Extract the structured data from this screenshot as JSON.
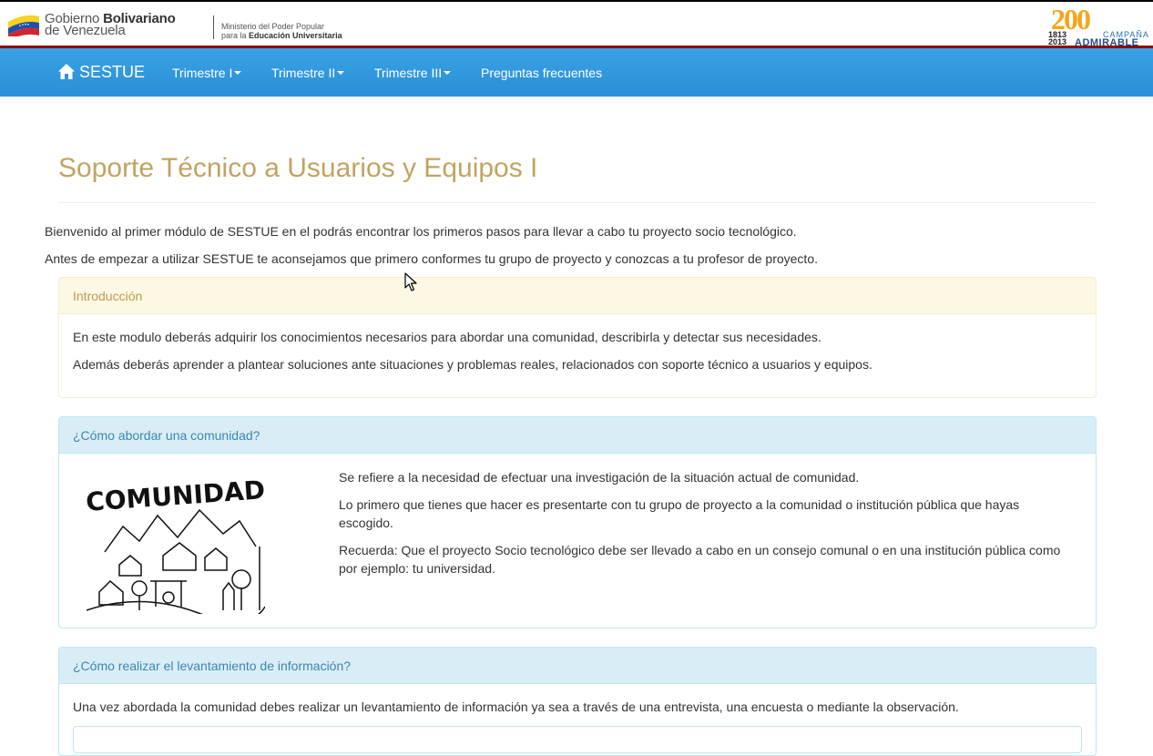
{
  "banner": {
    "gov_line1_a": "Gobierno ",
    "gov_line1_b": "Bolivariano",
    "gov_line2": "de Venezuela",
    "ministry_line1": "Ministerio del Poder Popular",
    "ministry_line2_a": "para la ",
    "ministry_line2_b": "Educación Universitaria",
    "campaign_number": "200",
    "campaign_year_start": "1813",
    "campaign_year_end": "2013",
    "campaign_word1": "CAMPAÑA",
    "campaign_word2": "ADMIRABLE"
  },
  "navbar": {
    "brand": "SESTUE",
    "items": [
      {
        "label": "Trimestre I",
        "dropdown": true
      },
      {
        "label": "Trimestre II",
        "dropdown": true
      },
      {
        "label": "Trimestre III",
        "dropdown": true
      },
      {
        "label": "Preguntas frecuentes",
        "dropdown": false
      }
    ]
  },
  "main": {
    "title": "Soporte Técnico a Usuarios y Equipos I",
    "intro": [
      "Bienvenido al primer módulo de SESTUE en el podrás encontrar los primeros pasos para llevar a cabo tu proyecto socio tecnológico.",
      "Antes de empezar a utilizar SESTUE te aconsejamos que primero conformes tu grupo de proyecto y conozcas a tu profesor de proyecto."
    ],
    "panels": [
      {
        "heading": "Introducción",
        "paragraphs": [
          "En este modulo deberás adquirir los conocimientos necesarios para abordar una comunidad, describirla y detectar sus necesidades.",
          "Además deberás aprender a plantear soluciones ante situaciones y problemas reales, relacionados con soporte técnico a usuarios y equipos."
        ]
      },
      {
        "heading": "¿Cómo abordar una comunidad?",
        "image_caption": "COMUNIDAD",
        "paragraphs": [
          "Se refiere a la necesidad de efectuar una investigación de la situación actual de comunidad.",
          "Lo primero que tienes que hacer es presentarte con tu grupo de proyecto a la comunidad o institución pública que hayas escogido.",
          "Recuerda: Que el proyecto Socio tecnológico debe ser llevado a cabo en un consejo comunal o en una institución pública como por ejemplo: tu universidad."
        ]
      },
      {
        "heading": "¿Cómo realizar el levantamiento de información?",
        "paragraphs": [
          "Una vez abordada la comunidad debes realizar un levantamiento de información ya sea a través de una entrevista, una encuesta o mediante la observación."
        ]
      }
    ]
  },
  "colors": {
    "navbar": "#2a8fd6",
    "title": "#c1a463",
    "warning_heading_bg": "#fcf8e3",
    "info_heading_bg": "#d9edf7",
    "banner_rule": "#8b0000"
  },
  "icons": [
    "venezuela-flag-icon",
    "home-icon",
    "caret-down-icon",
    "mouse-pointer-icon"
  ]
}
